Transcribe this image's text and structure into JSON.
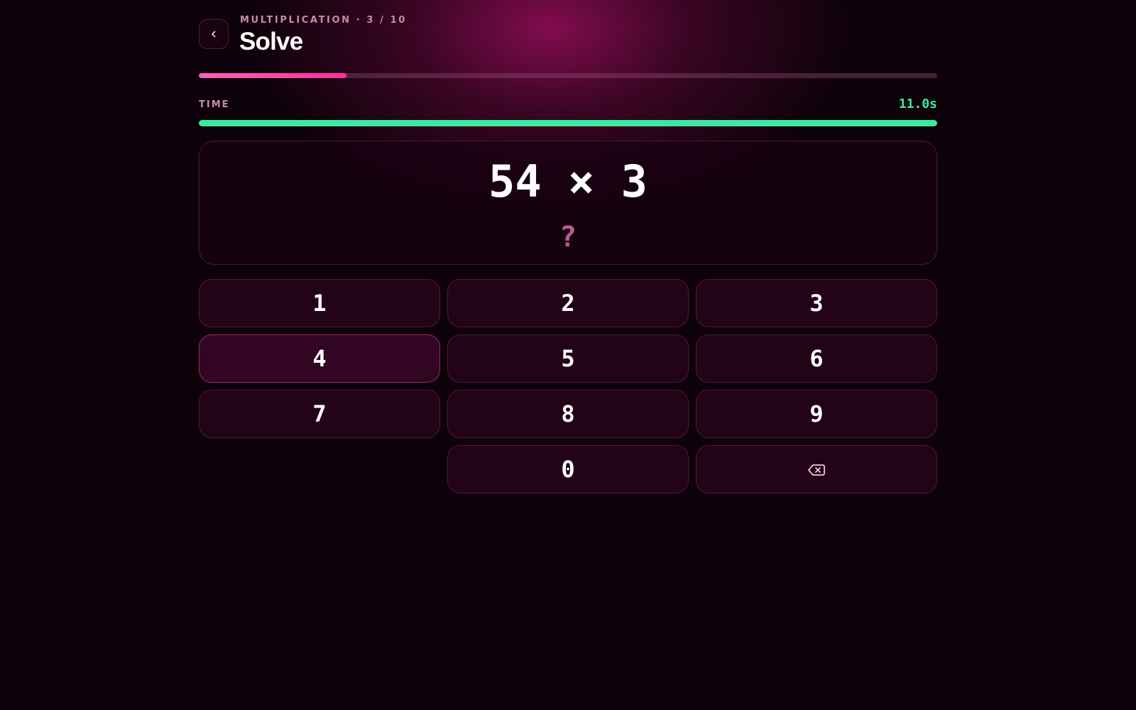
{
  "header": {
    "subtitle": "MULTIPLICATION · 3 / 10",
    "title": "Solve",
    "back_icon": "chevron-left-icon"
  },
  "progress": {
    "current": 3,
    "total": 10,
    "fraction": 0.2
  },
  "timer": {
    "label": "TIME",
    "value": "11.0s",
    "fraction": 1.0
  },
  "problem": {
    "equation": "54 × 3",
    "answer": "?"
  },
  "keypad": {
    "keys": [
      {
        "label": "1"
      },
      {
        "label": "2"
      },
      {
        "label": "3"
      },
      {
        "label": "4"
      },
      {
        "label": "5"
      },
      {
        "label": "6"
      },
      {
        "label": "7"
      },
      {
        "label": "8"
      },
      {
        "label": "9"
      },
      {
        "label": ""
      },
      {
        "label": "0"
      },
      {
        "label": "",
        "icon": "backspace-icon"
      }
    ]
  },
  "colors": {
    "accent": "#ff2f9c",
    "timer": "#3fe8a0",
    "muted_text": "#c98ab0",
    "answer_placeholder": "#b45d93"
  }
}
